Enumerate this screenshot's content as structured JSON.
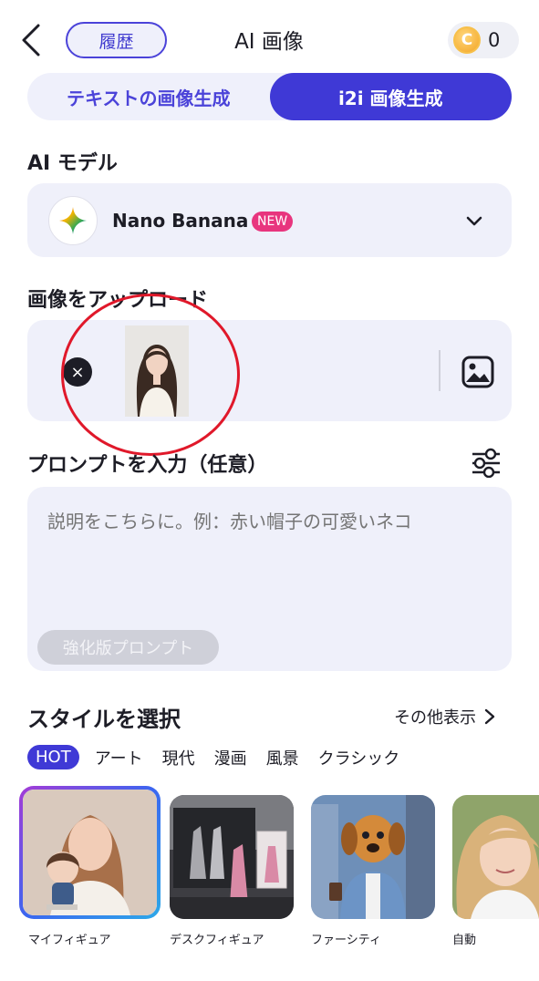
{
  "header": {
    "back_icon": "chevron-left-icon",
    "history_label": "履歴",
    "title": "AI 画像",
    "coin_icon": "coin-icon",
    "coin_symbol": "C",
    "coin_count": "0"
  },
  "tabs": [
    {
      "label": "テキストの画像生成",
      "active": false
    },
    {
      "label": "i2i 画像生成",
      "active": true
    }
  ],
  "model": {
    "section_label": "AI モデル",
    "name": "Nano Banana",
    "badge": "NEW",
    "logo_icon": "gemini-sparkle-icon",
    "dropdown_icon": "chevron-down-icon"
  },
  "upload": {
    "section_label": "画像をアップロード",
    "remove_icon": "close-icon",
    "remove_symbol": "×",
    "thumbnail": "uploaded-portrait",
    "gallery_icon": "image-gallery-icon"
  },
  "prompt": {
    "section_label": "プロンプトを入力（任意）",
    "settings_icon": "sliders-icon",
    "placeholder": "説明をこちらに。例：赤い帽子の可愛いネコ",
    "enhance_label": "強化版プロンプト"
  },
  "styles": {
    "section_label": "スタイルを選択",
    "more_label": "その他表示",
    "more_icon": "chevron-right-icon",
    "categories": [
      "HOT",
      "アート",
      "現代",
      "漫画",
      "風景",
      "クラシック"
    ],
    "active_category": "HOT",
    "items": [
      {
        "label": "マイフィギュア",
        "selected": true
      },
      {
        "label": "デスクフィギュア",
        "selected": false
      },
      {
        "label": "ファーシティ",
        "selected": false
      },
      {
        "label": "自動",
        "selected": false
      }
    ]
  },
  "colors": {
    "accent": "#3f39d6",
    "panel_bg": "#eff0fa",
    "badge_pink": "#e8357e",
    "annotation_red": "#e0182a"
  }
}
